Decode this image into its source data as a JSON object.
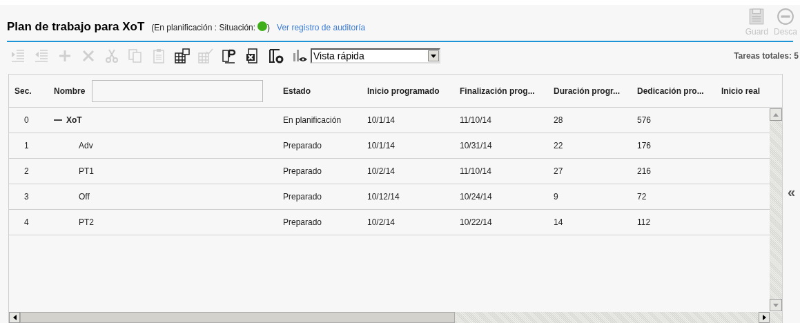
{
  "header": {
    "title": "Plan de trabajo para XoT",
    "status_text": "(En planificación : Situación:",
    "status_close": ")",
    "status_dot": {
      "color": "#3fae1a"
    },
    "audit_link": "Ver registro de auditoría",
    "actions": [
      {
        "kind": "save",
        "label": "Guard",
        "disabled": true
      },
      {
        "kind": "discard",
        "label": "Desca",
        "disabled": true
      }
    ]
  },
  "toolbar": {
    "tools": [
      {
        "kind": "indent",
        "disabled": true
      },
      {
        "kind": "outdent",
        "disabled": true
      },
      {
        "kind": "add",
        "disabled": true
      },
      {
        "kind": "delete",
        "disabled": true
      },
      {
        "kind": "cut",
        "disabled": true
      },
      {
        "kind": "copy",
        "disabled": true
      },
      {
        "kind": "paste",
        "disabled": true
      },
      {
        "kind": "grid",
        "disabled": false
      },
      {
        "kind": "gridcheck",
        "disabled": true
      },
      {
        "kind": "publish",
        "disabled": false
      },
      {
        "kind": "excel",
        "disabled": false
      },
      {
        "kind": "settings",
        "disabled": false
      },
      {
        "kind": "chartview",
        "disabled": false
      }
    ],
    "view_select": "Vista rápida",
    "total": "Tareas totales: 5"
  },
  "table": {
    "columns": [
      "Sec.",
      "Nombre",
      "Estado",
      "Inicio programado",
      "Finalización prog...",
      "Duración progr...",
      "Dedicación pro...",
      "Inicio real"
    ],
    "rows": [
      {
        "seq": "0",
        "name": "XoT",
        "expanded": true,
        "status": "En planificación",
        "start": "10/1/14",
        "finish": "11/10/14",
        "duration": "28",
        "effort": "576",
        "children": [
          {
            "seq": "1",
            "name": "Adv",
            "status": "Preparado",
            "start": "10/1/14",
            "finish": "10/31/14",
            "duration": "22",
            "effort": "176"
          },
          {
            "seq": "2",
            "name": "PT1",
            "status": "Preparado",
            "start": "10/2/14",
            "finish": "11/10/14",
            "duration": "27",
            "effort": "216"
          },
          {
            "seq": "3",
            "name": "Off",
            "status": "Preparado",
            "start": "10/12/14",
            "finish": "10/24/14",
            "duration": "9",
            "effort": "72"
          },
          {
            "seq": "4",
            "name": "PT2",
            "status": "Preparado",
            "start": "10/2/14",
            "finish": "10/22/14",
            "duration": "14",
            "effort": "112"
          }
        ]
      }
    ]
  },
  "collapse_toggle": "«"
}
